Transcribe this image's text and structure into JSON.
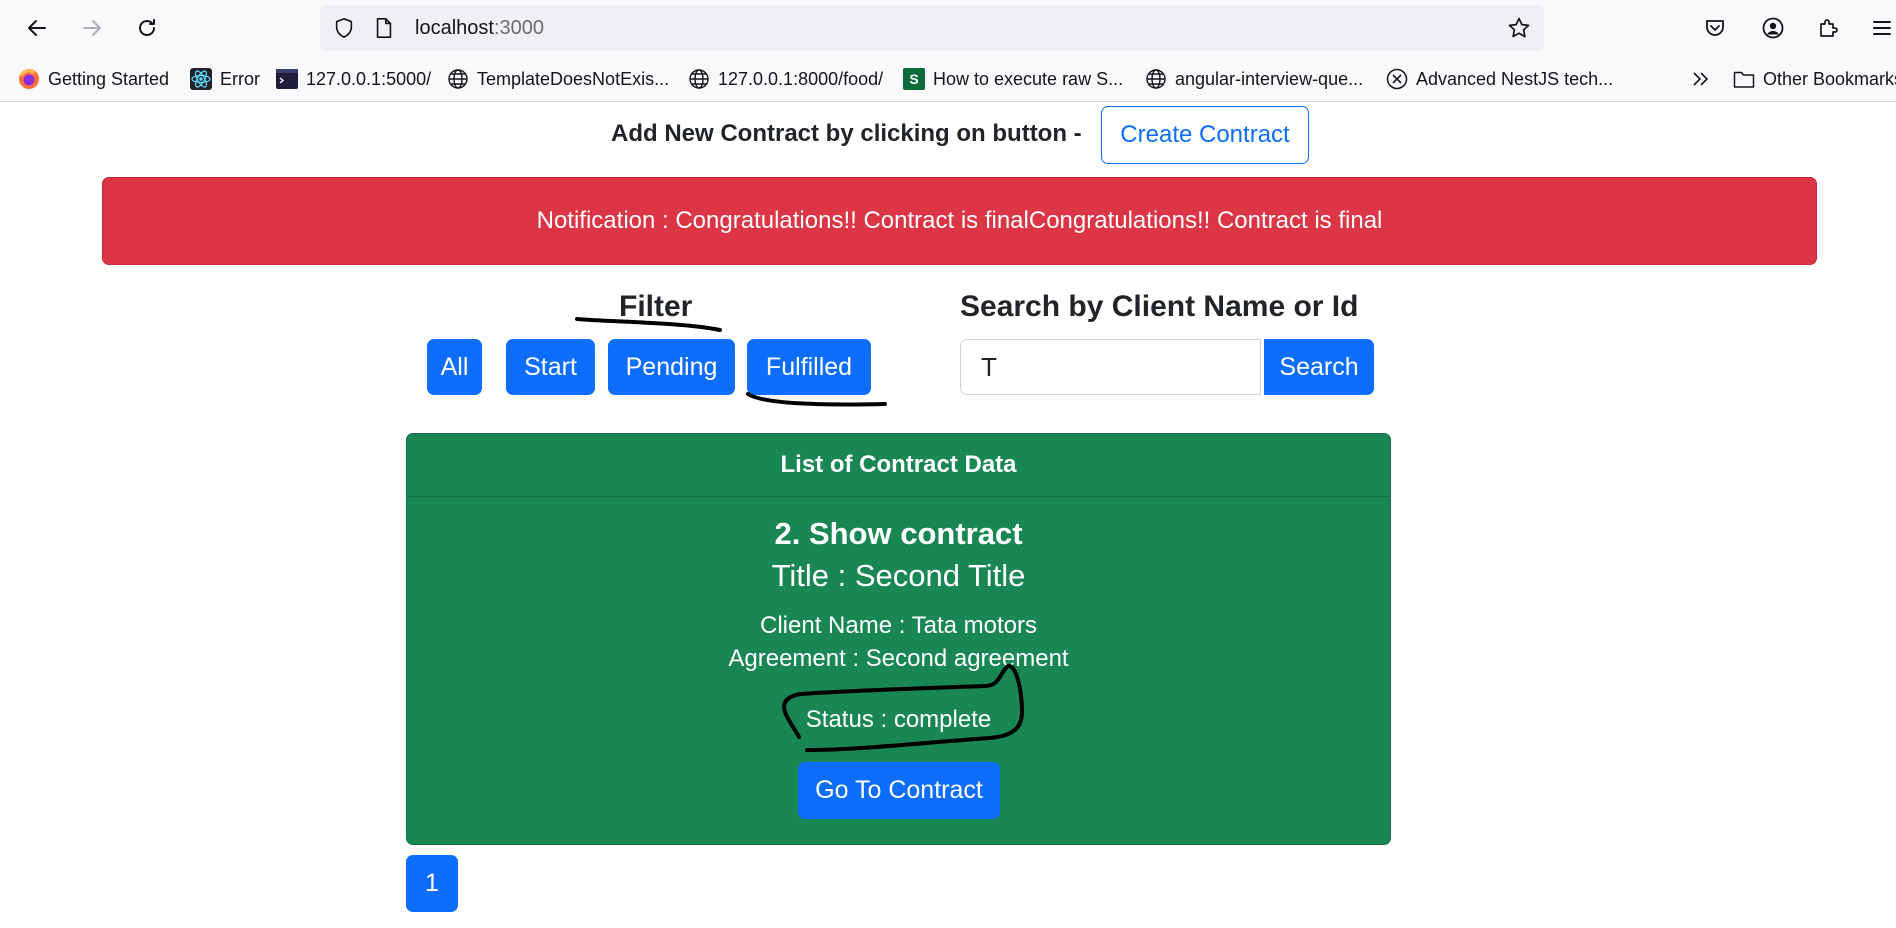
{
  "browser": {
    "url_host": "localhost",
    "url_port": ":3000",
    "bookmarks": [
      {
        "label": "Getting Started",
        "icon": "firefox-icon"
      },
      {
        "label": "Error",
        "icon": "react-icon"
      },
      {
        "label": "127.0.0.1:5000/",
        "icon": "terminal-icon"
      },
      {
        "label": "TemplateDoesNotExis...",
        "icon": "globe-icon"
      },
      {
        "label": "127.0.0.1:8000/food/",
        "icon": "globe-icon"
      },
      {
        "label": "How to execute raw S...",
        "icon": "s-icon"
      },
      {
        "label": "angular-interview-que...",
        "icon": "globe-icon"
      },
      {
        "label": "Advanced NestJS tech...",
        "icon": "x-circle-icon"
      }
    ],
    "other_bookmarks": "Other Bookmarks"
  },
  "header": {
    "add_text": "Add New Contract by clicking on button -",
    "create_button": "Create Contract"
  },
  "notification": {
    "text": "Notification : Congratulations!! Contract is finalCongratulations!! Contract is final"
  },
  "filter": {
    "title": "Filter",
    "buttons": [
      "All",
      "Start",
      "Pending",
      "Fulfilled"
    ]
  },
  "search": {
    "title": "Search by Client Name or Id",
    "value": "T",
    "button": "Search"
  },
  "contract_list": {
    "header": "List of Contract Data",
    "item": {
      "heading": "2. Show contract",
      "title": "Title : Second Title",
      "client": "Client Name : Tata motors",
      "agreement": "Agreement : Second agreement",
      "status": "Status : complete",
      "button": "Go To Contract"
    }
  },
  "pagination": {
    "page": "1"
  },
  "colors": {
    "primary": "#0d6efd",
    "success": "#198754",
    "danger": "#dc3545"
  }
}
